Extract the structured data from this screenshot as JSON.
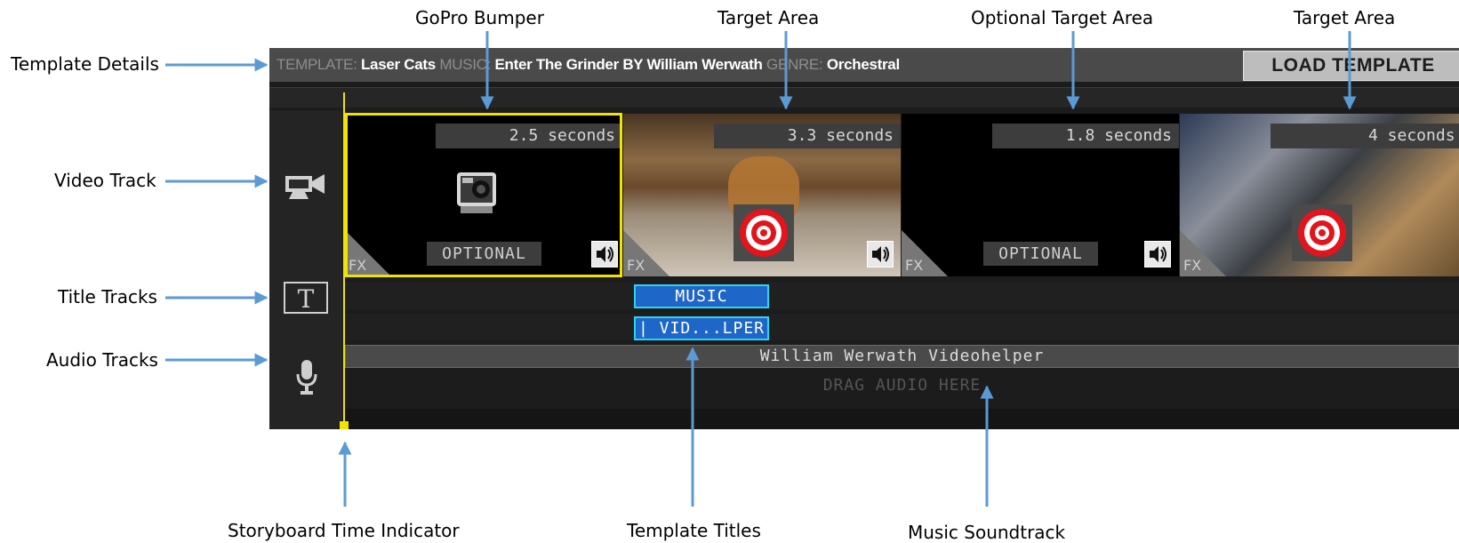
{
  "callouts": {
    "gopro_bumper": "GoPro Bumper",
    "target_area_1": "Target Area",
    "optional_target_area": "Optional Target Area",
    "target_area_2": "Target Area",
    "template_details": "Template Details",
    "video_track": "Video Track",
    "title_tracks": "Title Tracks",
    "audio_tracks": "Audio Tracks",
    "storyboard_time_indicator": "Storyboard Time Indicator",
    "template_titles": "Template Titles",
    "music_soundtrack": "Music Soundtrack"
  },
  "topbar": {
    "template_label": "TEMPLATE:",
    "template_value": "Laser Cats",
    "music_label": "MUSIC:",
    "music_value": "Enter The Grinder BY William Werwath",
    "genre_label": "GENRE:",
    "genre_value": "Orchestral",
    "load_button": "LOAD TEMPLATE"
  },
  "track_icons": [
    "video-camera-icon",
    "title-t-icon",
    "microphone-icon"
  ],
  "clips": [
    {
      "duration": "2.5 seconds",
      "type": "gopro-bumper",
      "optional_label": "OPTIONAL",
      "fx_label": "FX",
      "selected": true
    },
    {
      "duration": "3.3 seconds",
      "type": "target",
      "fx_label": "FX"
    },
    {
      "duration": "1.8 seconds",
      "type": "optional-target",
      "optional_label": "OPTIONAL",
      "fx_label": "FX"
    },
    {
      "duration": "4 seconds",
      "type": "target",
      "fx_label": "FX"
    }
  ],
  "titles": [
    "MUSIC",
    "| VID...LPER"
  ],
  "audio": {
    "music_track": "William Werwath  Videohelper",
    "drag_placeholder": "DRAG AUDIO HERE"
  },
  "colors": {
    "accent_yellow": "#f2e200",
    "title_chip_blue": "#1f66c9",
    "title_chip_border": "#28d6ef",
    "callout_arrow": "#5b9bd5",
    "target_red": "#e3141b"
  }
}
